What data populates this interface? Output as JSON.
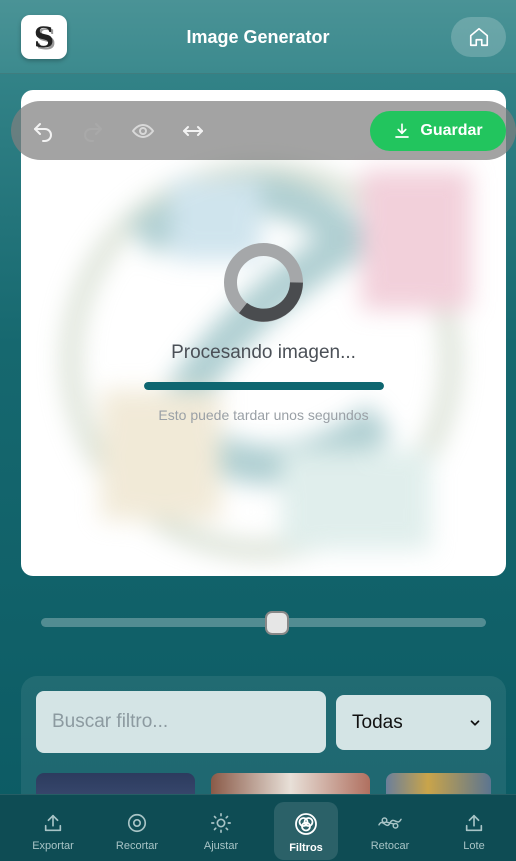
{
  "header": {
    "logo_letter": "S",
    "title": "Image Generator",
    "home_icon": "home-icon"
  },
  "toolbar": {
    "tools": [
      {
        "name": "undo-icon"
      },
      {
        "name": "redo-icon"
      },
      {
        "name": "eye-icon"
      },
      {
        "name": "compare-arrows-icon"
      }
    ],
    "save_label": "Guardar",
    "save_icon": "download-icon"
  },
  "processing": {
    "message": "Procesando imagen...",
    "hint": "Esto puede tardar unos segundos",
    "progress": 1.0
  },
  "slider": {
    "value": 0.53
  },
  "filters": {
    "search_placeholder": "Buscar filtro...",
    "category_selected": "Todas"
  },
  "nav": {
    "items": [
      {
        "label": "Exportar",
        "icon": "upload-icon",
        "active": false
      },
      {
        "label": "Recortar",
        "icon": "crop-circle-icon",
        "active": false
      },
      {
        "label": "Ajustar",
        "icon": "sun-icon",
        "active": false
      },
      {
        "label": "Filtros",
        "icon": "filters-icon",
        "active": true
      },
      {
        "label": "Retocar",
        "icon": "retouch-icon",
        "active": false
      },
      {
        "label": "Lote",
        "icon": "batch-upload-icon",
        "active": false
      }
    ]
  },
  "colors": {
    "accent": "#22c55e",
    "brand": "#0e6670",
    "nav_bg": "#0e4c54"
  }
}
